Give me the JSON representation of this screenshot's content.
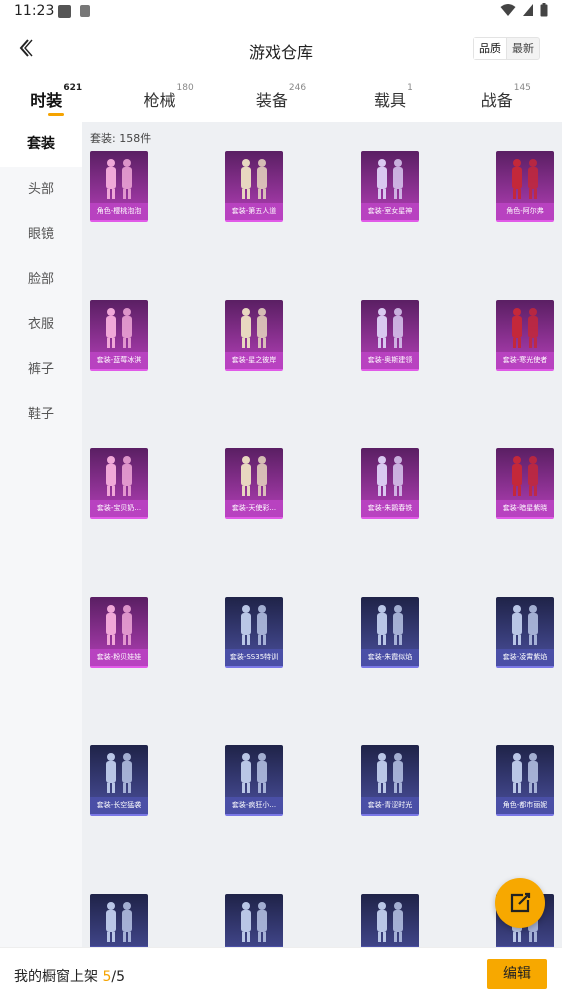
{
  "status_bar": {
    "time": "11:23"
  },
  "header": {
    "title": "游戏仓库",
    "sort_options": [
      "品质",
      "最新"
    ],
    "sort_selected": "品质"
  },
  "tabs": [
    {
      "label": "时装",
      "count": "621",
      "active": true
    },
    {
      "label": "枪械",
      "count": "180"
    },
    {
      "label": "装备",
      "count": "246"
    },
    {
      "label": "载具",
      "count": "1"
    },
    {
      "label": "战备",
      "count": "145"
    }
  ],
  "sidenav": [
    {
      "label": "套装",
      "active": true
    },
    {
      "label": "头部"
    },
    {
      "label": "眼镜"
    },
    {
      "label": "脸部"
    },
    {
      "label": "衣服"
    },
    {
      "label": "裤子"
    },
    {
      "label": "鞋子"
    }
  ],
  "grid": {
    "count_label": "套装: 158件",
    "items": [
      {
        "name": "角色-樱桃泡泡",
        "rarity": "purple"
      },
      {
        "name": "套装-第五人道",
        "rarity": "purple"
      },
      {
        "name": "套装-室女星神",
        "rarity": "purple"
      },
      {
        "name": "角色-阿尔弗",
        "rarity": "purple"
      },
      {
        "name": "套装-蓝莓冰淇",
        "rarity": "purple"
      },
      {
        "name": "套装-星之彼岸",
        "rarity": "purple"
      },
      {
        "name": "套装-奥斯建领",
        "rarity": "purple"
      },
      {
        "name": "套装-寒光使者",
        "rarity": "purple"
      },
      {
        "name": "套装-宝贝奶...",
        "rarity": "purple"
      },
      {
        "name": "套装-天使彩...",
        "rarity": "purple"
      },
      {
        "name": "套装-朱鹮春铁",
        "rarity": "purple"
      },
      {
        "name": "套装-暗星紫晓",
        "rarity": "purple"
      },
      {
        "name": "套装-粉贝娃娃",
        "rarity": "purple"
      },
      {
        "name": "套装-SS35特训",
        "rarity": "blue"
      },
      {
        "name": "套装-朱霞似焰",
        "rarity": "blue"
      },
      {
        "name": "套装-凌霄紫焰",
        "rarity": "blue"
      },
      {
        "name": "套装-长空猛袭",
        "rarity": "blue"
      },
      {
        "name": "套装-疯狂小...",
        "rarity": "blue"
      },
      {
        "name": "套装-青涩时光",
        "rarity": "blue"
      },
      {
        "name": "角色-都市丽妮",
        "rarity": "blue"
      },
      {
        "name": "",
        "rarity": "blue"
      },
      {
        "name": "",
        "rarity": "blue"
      },
      {
        "name": "",
        "rarity": "blue"
      },
      {
        "name": "",
        "rarity": "blue"
      }
    ]
  },
  "bottom_bar": {
    "label": "我的橱窗上架",
    "current": "5",
    "separator": "/",
    "total": "5",
    "edit_label": "编辑"
  },
  "colors": {
    "accent": "#f7a800",
    "purple_card": "#b842c0",
    "blue_card": "#4a4fa6"
  }
}
